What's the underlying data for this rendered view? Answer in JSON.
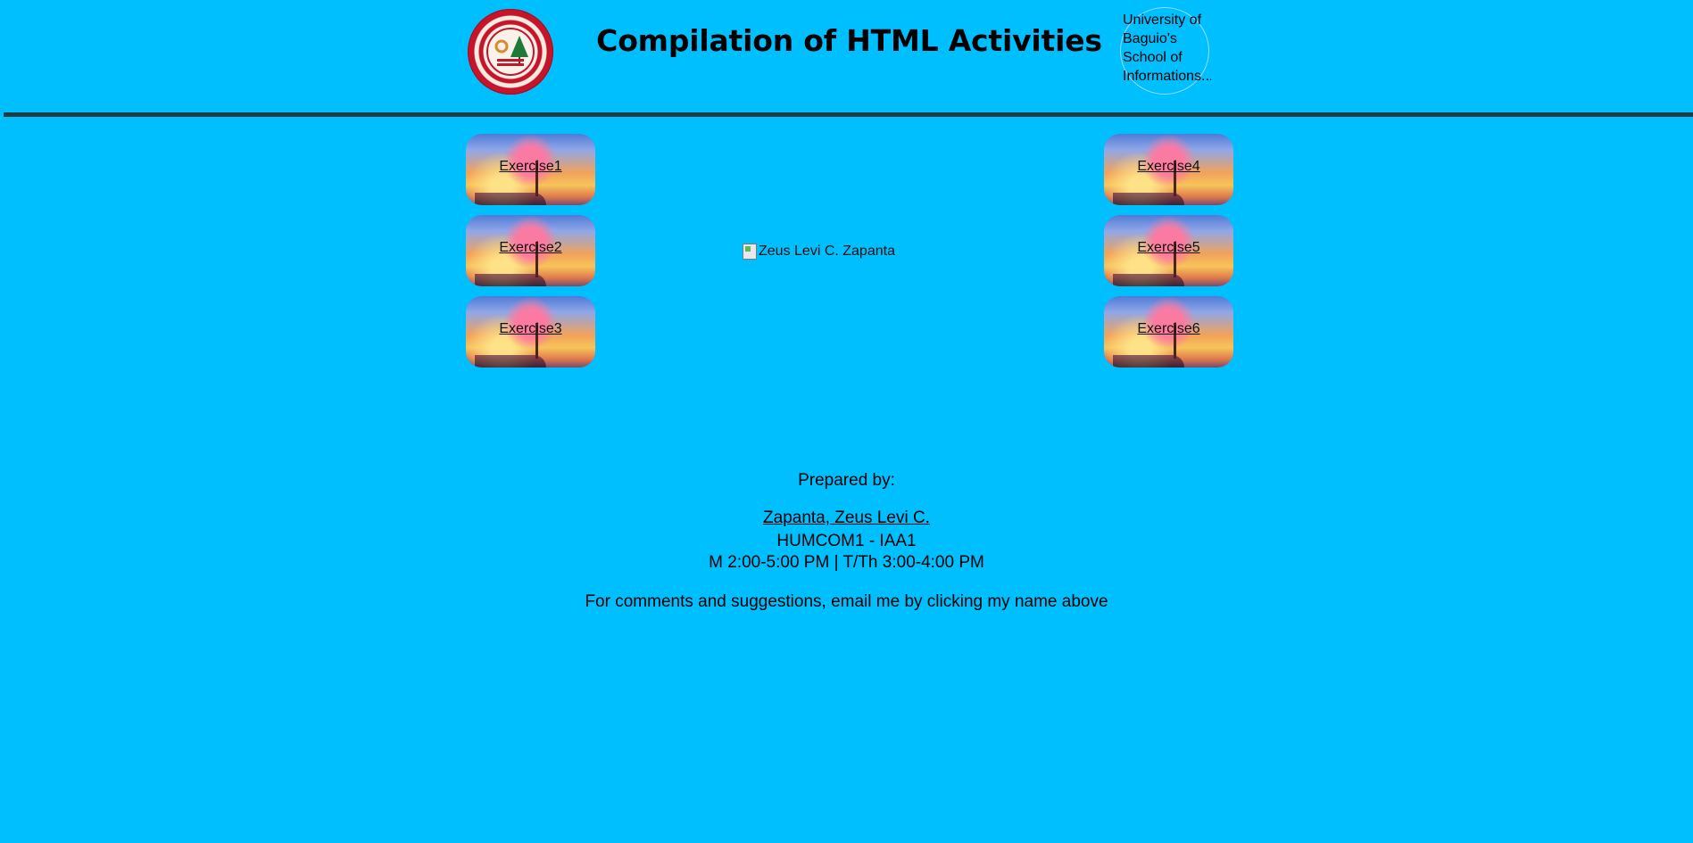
{
  "header": {
    "title": "Compilation of HTML Activities",
    "logo_alt": "University of Baguio's School of Informations..."
  },
  "exercises": [
    {
      "label": "Exercise1"
    },
    {
      "label": "Exercise2"
    },
    {
      "label": "Exercise3"
    },
    {
      "label": "Exercise4"
    },
    {
      "label": "Exercise5"
    },
    {
      "label": "Exercise6"
    }
  ],
  "profile_image_alt": "Zeus Levi C. Zapanta",
  "footer": {
    "prepared_label": "Prepared by:",
    "name": "Zapanta, Zeus Levi C.",
    "course": "HUMCOM1 - IAA1",
    "schedule": "M 2:00-5:00 PM | T/Th 3:00-4:00 PM",
    "comments": "For comments and suggestions, email me by clicking my name above"
  },
  "colors": {
    "background": "#00bfff",
    "divider": "#1f3a44",
    "seal_red": "#c6142a"
  },
  "icons": {
    "seal": "university-seal-icon",
    "broken_image": "broken-image-icon"
  }
}
